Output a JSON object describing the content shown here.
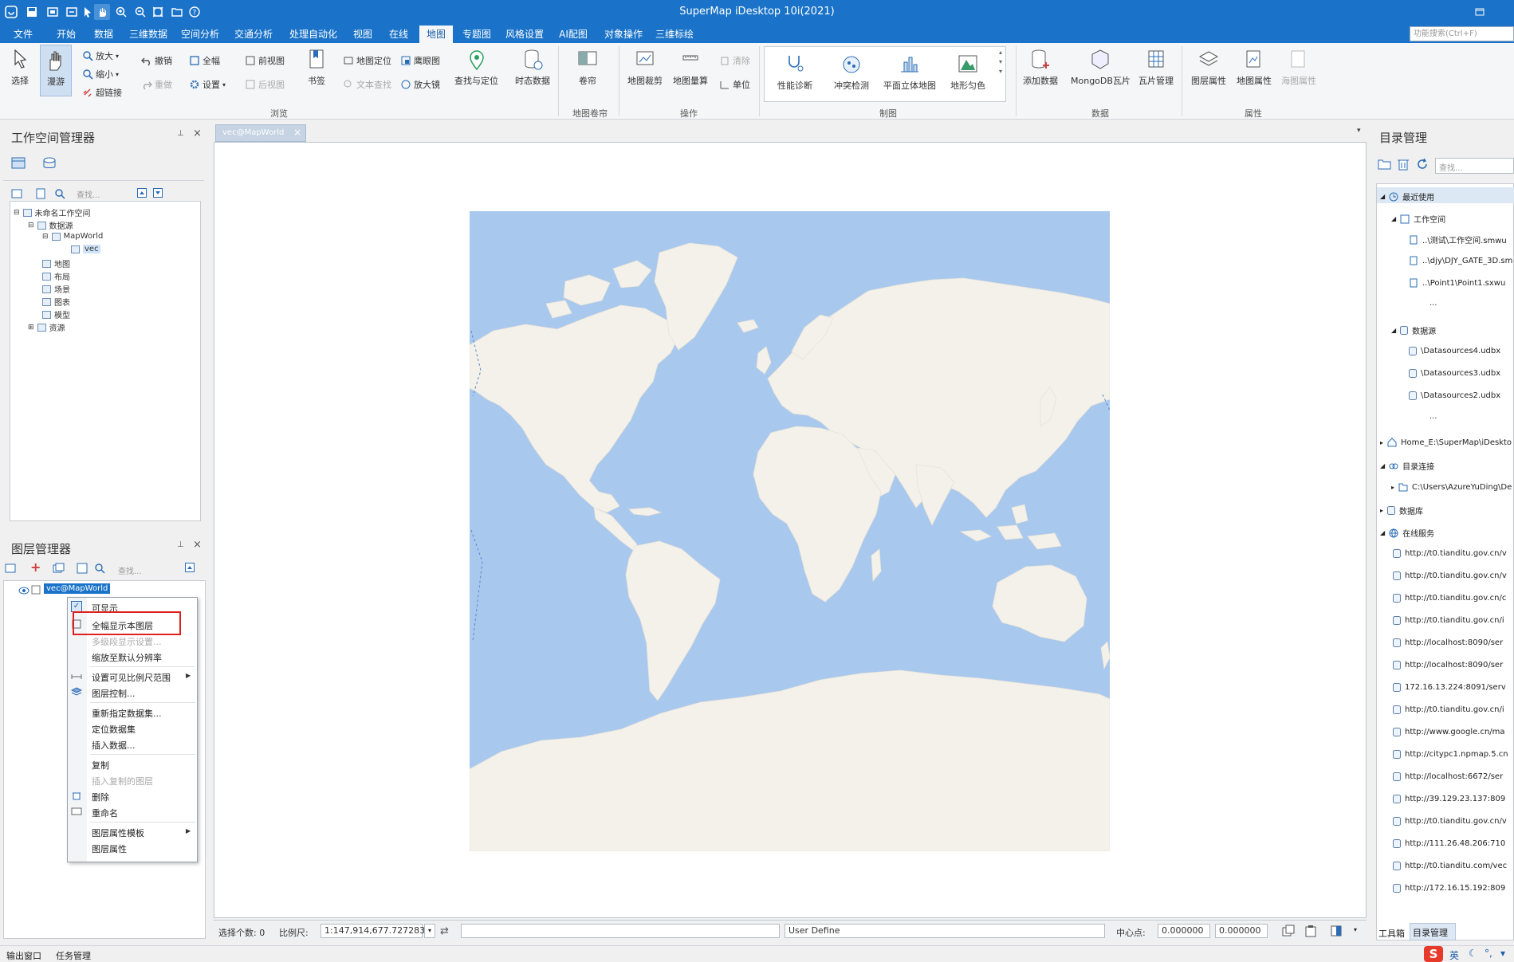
{
  "app": {
    "title": "SuperMap iDesktop 10i(2021)"
  },
  "menu_tabs": [
    {
      "label": "文件"
    },
    {
      "label": "开始"
    },
    {
      "label": "数据"
    },
    {
      "label": "三维数据"
    },
    {
      "label": "空间分析"
    },
    {
      "label": "交通分析"
    },
    {
      "label": "处理自动化"
    },
    {
      "label": "视图"
    },
    {
      "label": "在线"
    },
    {
      "label": "地图"
    },
    {
      "label": "专题图"
    },
    {
      "label": "风格设置"
    },
    {
      "label": "AI配图"
    },
    {
      "label": "对象操作"
    },
    {
      "label": "三维标绘"
    }
  ],
  "active_tab": "地图",
  "function_search": {
    "placeholder": "功能搜索(Ctrl+F)"
  },
  "ribbon": {
    "select": "选择",
    "pan": "漫游",
    "zoom_in": "放大",
    "zoom_out": "缩小",
    "hyperlink": "超链接",
    "undo": "撤销",
    "redo": "重做",
    "full_extent": "全幅",
    "settings": "设置",
    "prev_view": "前视图",
    "next_view": "后视图",
    "bookmark": "书签",
    "locate": "地图定位",
    "eagle_eye": "鹰眼图",
    "text_search": "文本查找",
    "magnifier": "放大镜",
    "find_locate": "查找与定位",
    "temporal": "时态数据",
    "browse_group": "浏览",
    "swipe": "卷帘",
    "swipe_group": "地图卷帘",
    "map_clip": "地图裁剪",
    "map_measure": "地图量算",
    "clear": "清除",
    "unit": "单位",
    "ops_group": "操作",
    "perf": "性能诊断",
    "conflict": "冲突检测",
    "planar3d": "平面立体地图",
    "terrain": "地形匀色",
    "carto_group": "制图",
    "add_data": "添加数据",
    "mongodb": "MongoDB瓦片",
    "tile_mgr": "瓦片管理",
    "data_group": "数据",
    "layer_prop": "图层属性",
    "map_prop": "地图属性",
    "chart_prop": "海图属性",
    "prop_group": "属性"
  },
  "workspace_panel": {
    "title": "工作空间管理器",
    "search_placeholder": "查找...",
    "tree": [
      {
        "label": "未命名工作空间"
      },
      {
        "label": "数据源"
      },
      {
        "label": "MapWorld"
      },
      {
        "label": "vec"
      },
      {
        "label": "地图"
      },
      {
        "label": "布局"
      },
      {
        "label": "场景"
      },
      {
        "label": "图表"
      },
      {
        "label": "模型"
      },
      {
        "label": "资源"
      }
    ]
  },
  "layer_panel": {
    "title": "图层管理器",
    "search_placeholder": "查找...",
    "layer": "vec@MapWorld"
  },
  "context_menu": {
    "items": [
      {
        "label": "可显示"
      },
      {
        "label": "全幅显示本图层"
      },
      {
        "label": "多级段显示设置..."
      },
      {
        "label": "缩放至默认分辨率"
      },
      {
        "label": "设置可见比例尺范围"
      },
      {
        "label": "图层控制..."
      },
      {
        "label": "重新指定数据集..."
      },
      {
        "label": "定位数据集"
      },
      {
        "label": "插入数据..."
      },
      {
        "label": "复制"
      },
      {
        "label": "插入复制的图层"
      },
      {
        "label": "删除"
      },
      {
        "label": "重命名"
      },
      {
        "label": "图层属性模板"
      },
      {
        "label": "图层属性"
      }
    ],
    "highlighted": "全幅显示本图层"
  },
  "map": {
    "tab_label": "vec@MapWorld",
    "colors": {
      "ocean": "#a9c8ee",
      "land": "#f3f1ea"
    }
  },
  "statusbar": {
    "select_count_label": "选择个数: 0",
    "scale_label": "比例尺:",
    "scale_value": "1:147,914,677.727283",
    "projection": "User Define",
    "center_label": "中心点:",
    "center_x": "0.000000",
    "center_y": "0.000000"
  },
  "catalog_panel": {
    "title": "目录管理",
    "search_placeholder": "查找...",
    "recent": "最近使用",
    "workspace_group": "工作空间",
    "workspaces": [
      "..\\测试\\工作空间.smwu",
      "..\\djy\\DJY_GATE_3D.sm",
      "..\\Point1\\Point1.sxwu",
      "..."
    ],
    "datasource_group": "数据源",
    "datasources": [
      "\\Datasources4.udbx",
      "\\Datasources3.udbx",
      "\\Datasources2.udbx",
      "..."
    ],
    "home": "Home_E:\\SuperMap\\iDeskto",
    "dir_conn": "目录连接",
    "dir_path": "C:\\Users\\AzureYuDing\\De",
    "database": "数据库",
    "online": "在线服务",
    "services": [
      "http://t0.tianditu.gov.cn/v",
      "http://t0.tianditu.gov.cn/v",
      "http://t0.tianditu.gov.cn/c",
      "http://t0.tianditu.gov.cn/i",
      "http://localhost:8090/ser",
      "http://localhost:8090/ser",
      "172.16.13.224:8091/serv",
      "http://t0.tianditu.gov.cn/i",
      "http://www.google.cn/ma",
      "http://citypc1.npmap.5.cn",
      "http://localhost:6672/ser",
      "http://39.129.23.137:809",
      "http://t0.tianditu.gov.cn/v",
      "http://111.26.48.206:710",
      "http://t0.tianditu.com/vec",
      "http://172.16.15.192:809"
    ],
    "tab_toolbox": "工具箱",
    "tab_catalog": "目录管理"
  },
  "bottom": {
    "output": "输出窗口",
    "tasks": "任务管理",
    "ime": "英"
  }
}
